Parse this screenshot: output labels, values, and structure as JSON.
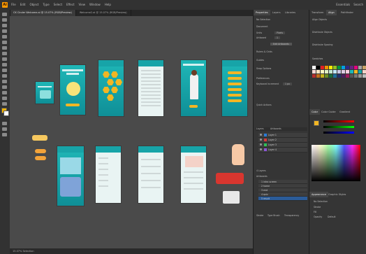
{
  "menu": {
    "items": [
      "File",
      "Edit",
      "Object",
      "Type",
      "Select",
      "Effect",
      "View",
      "Window",
      "Help"
    ],
    "right": [
      "Essentials",
      "Search"
    ]
  },
  "tabs": [
    {
      "label": "CK Cinder Welcome.ai @ 15.07% (RGB/Preview)",
      "active": true
    },
    {
      "label": "Welcome2.ai @ 15.07% (RGB/Preview)",
      "active": false
    }
  ],
  "properties": {
    "tabs": [
      "Properties",
      "Layers",
      "Libraries"
    ],
    "no_selection": "No Selection",
    "document": "Document",
    "units_label": "Units",
    "units_value": "Pixels",
    "artboard_label": "Artboard",
    "artboard_value": "1",
    "edit_artboards": "Edit Artboards",
    "rulers": "Rulers & Grids",
    "guides": "Guides",
    "snap": "Snap Options",
    "preferences": "Preferences",
    "keyboard": "Keyboard Increment",
    "keyboard_value": "1 px",
    "quick_actions": "Quick Actions"
  },
  "transform": {
    "tabs": [
      "Transform",
      "Align",
      "Pathfinder"
    ],
    "align": "Align Objects",
    "distribute": "Distribute Objects",
    "spacing": "Distribute Spacing",
    "swatches": "Swatches"
  },
  "color": {
    "tabs": [
      "Color",
      "Color Guide",
      "Gradient"
    ]
  },
  "appearance": {
    "tabs": [
      "Appearance",
      "Graphic Styles"
    ],
    "no_selection": "No Selection",
    "stroke": "Stroke",
    "fill": "Fill",
    "opacity": "Opacity",
    "opacity_value": "Default"
  },
  "layers": {
    "tabs": [
      "Layers",
      "Artboards"
    ],
    "items": [
      "Layer 1",
      "Layer 2",
      "Layer 3",
      "Layer 4"
    ],
    "count": "4 Layers"
  },
  "artboards": {
    "tabs": [
      "Artboards",
      "Properties"
    ],
    "items": [
      "1  intro screen",
      "2  home",
      "3  end",
      "4  quiz",
      "5  result",
      "6  menu"
    ]
  },
  "character": {
    "tabs": [
      "Stroke",
      "Type Brush",
      "Transparency"
    ]
  },
  "status": "15.07%    Selection"
}
